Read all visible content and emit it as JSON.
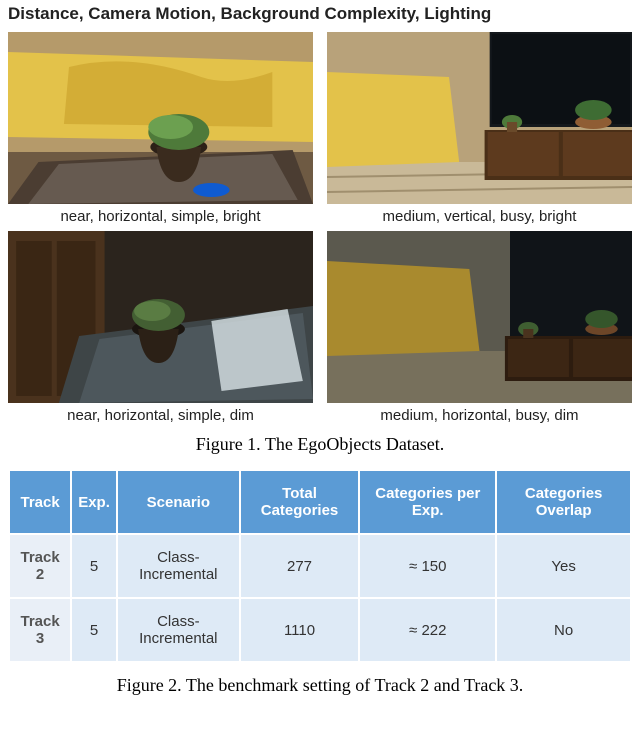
{
  "attr_header": "Distance, Camera Motion, Background Complexity, Lighting",
  "thumbs": [
    {
      "caption": "near, horizontal, simple, bright"
    },
    {
      "caption": "medium, vertical, busy, bright"
    },
    {
      "caption": "near, horizontal, simple, dim"
    },
    {
      "caption": "medium, horizontal, busy, dim"
    }
  ],
  "figure1_caption": "Figure 1. The EgoObjects Dataset.",
  "table": {
    "headers": [
      "Track",
      "Exp.",
      "Scenario",
      "Total Categories",
      "Categories per Exp.",
      "Categories Overlap"
    ],
    "rows": [
      {
        "track": "Track 2",
        "exp": "5",
        "scenario": "Class-Incremental",
        "total": "277",
        "per": "≈ 150",
        "overlap": "Yes"
      },
      {
        "track": "Track 3",
        "exp": "5",
        "scenario": "Class-Incremental",
        "total": "1110",
        "per": "≈ 222",
        "overlap": "No"
      }
    ]
  },
  "figure2_caption": "Figure 2. The benchmark setting of Track 2 and Track 3.",
  "chart_data": {
    "type": "table",
    "title": "The benchmark setting of Track 2 and Track 3",
    "columns": [
      "Track",
      "Exp.",
      "Scenario",
      "Total Categories",
      "Categories per Exp.",
      "Categories Overlap"
    ],
    "rows": [
      [
        "Track 2",
        5,
        "Class-Incremental",
        277,
        "≈ 150",
        "Yes"
      ],
      [
        "Track 3",
        5,
        "Class-Incremental",
        1110,
        "≈ 222",
        "No"
      ]
    ]
  }
}
